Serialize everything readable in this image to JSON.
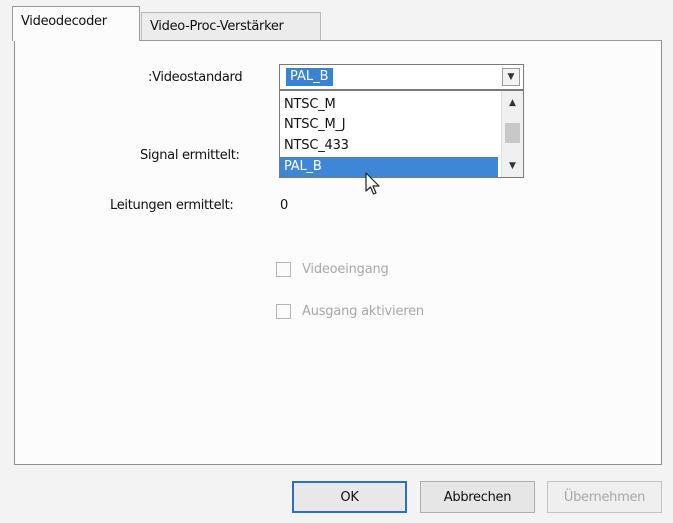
{
  "tabs": [
    {
      "label": "Videodecoder",
      "active": true
    },
    {
      "label": "Video-Proc-Verstärker",
      "active": false
    }
  ],
  "form": {
    "videostandard_label": ":Videostandard",
    "videostandard_value": "PAL_B",
    "signal_label": "Signal ermittelt:",
    "leitungen_label": "Leitungen ermittelt:",
    "leitungen_value": "0"
  },
  "dropdown_options": [
    "NTSC_M",
    "NTSC_M_J",
    "NTSC_433",
    "PAL_B"
  ],
  "dropdown_selected_index": 3,
  "checkboxes": {
    "videoeingang": {
      "label": "Videoeingang",
      "checked": false,
      "enabled": false
    },
    "ausgang": {
      "label": "Ausgang aktivieren",
      "checked": false,
      "enabled": false
    }
  },
  "buttons": {
    "ok": "OK",
    "cancel": "Abbrechen",
    "apply": "Übernehmen"
  },
  "icons": {
    "dropdown_arrow": "chevron-down-icon",
    "scroll_up": "chevron-up-icon",
    "scroll_down": "chevron-down-icon",
    "cursor": "mouse-pointer-icon"
  }
}
